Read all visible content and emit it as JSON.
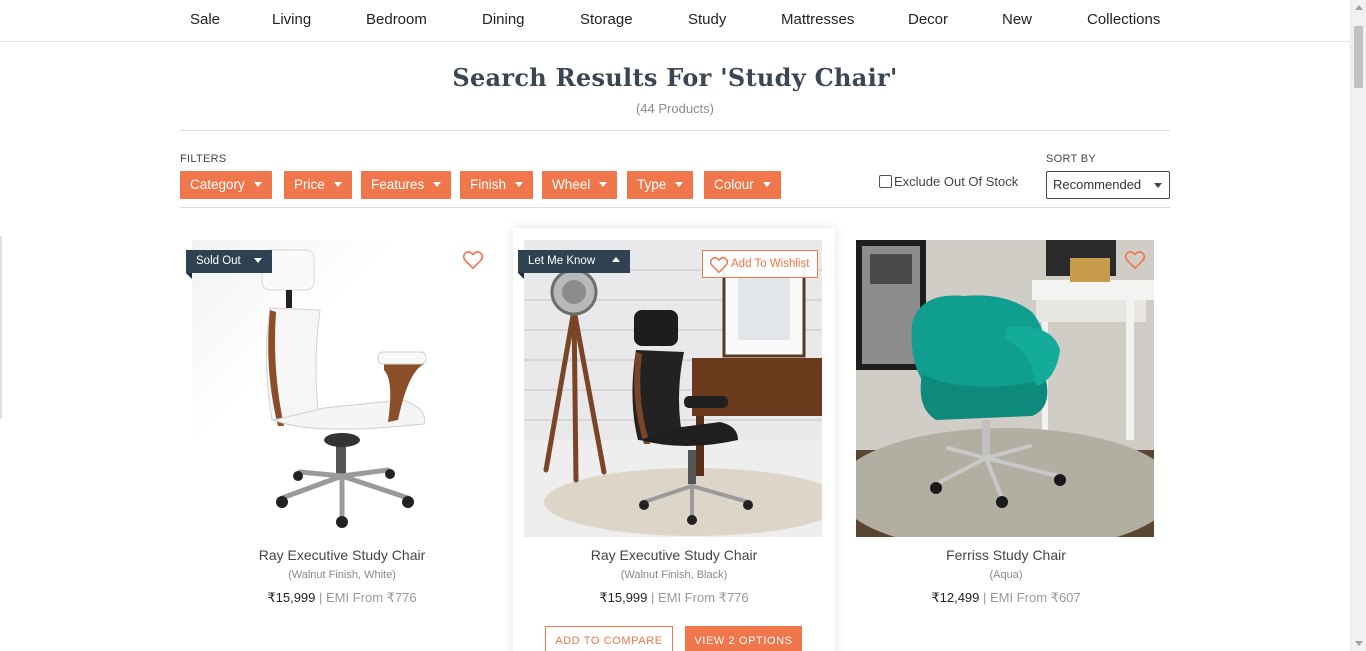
{
  "nav": {
    "items": [
      "Sale",
      "Living",
      "Bedroom",
      "Dining",
      "Storage",
      "Study",
      "Mattresses",
      "Decor",
      "New",
      "Collections"
    ]
  },
  "search": {
    "title": "Search Results For 'Study Chair'",
    "count": "(44 Products)"
  },
  "filters": {
    "label": "FILTERS",
    "buttons": [
      "Category",
      "Price",
      "Features",
      "Finish",
      "Wheel",
      "Type",
      "Colour"
    ],
    "exclude_label": "Exclude Out Of Stock"
  },
  "sort": {
    "label": "SORT BY",
    "selected": "Recommended"
  },
  "products": [
    {
      "name": "Ray Executive Study Chair",
      "variant": "(Walnut Finish, White)",
      "price": "₹15,999",
      "emi": " | EMI From ₹776",
      "badge": "Sold Out"
    },
    {
      "name": "Ray Executive Study Chair",
      "variant": "(Walnut Finish, Black)",
      "price": "₹15,999",
      "emi": " | EMI From ₹776",
      "badge": "Let Me Know",
      "wishlist_label": "Add To Wishlist",
      "compare_label": "ADD TO COMPARE",
      "options_label": "VIEW 2 OPTIONS"
    },
    {
      "name": "Ferriss Study Chair",
      "variant": "(Aqua)",
      "price": "₹12,499",
      "emi": " | EMI From ₹607"
    }
  ],
  "colors": {
    "accent": "#f0774b",
    "badge": "#2f4252",
    "title": "#3a4654"
  }
}
